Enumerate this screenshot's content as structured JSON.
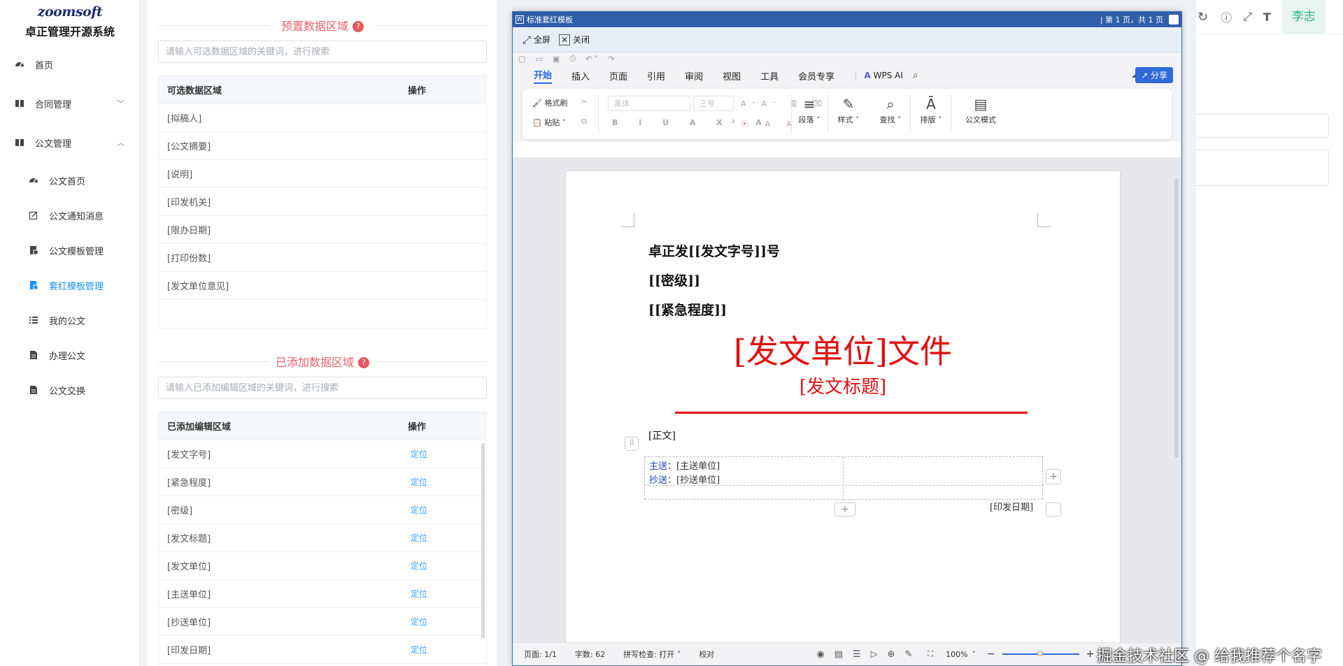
{
  "sidebar": {
    "brand": "zoomsoft",
    "system_name": "卓正管理开源系统",
    "items": [
      {
        "label": "首页"
      },
      {
        "label": "合同管理"
      },
      {
        "label": "公文管理"
      },
      {
        "label": "公文首页"
      },
      {
        "label": "公文通知消息"
      },
      {
        "label": "公文模板管理"
      },
      {
        "label": "套红模板管理"
      },
      {
        "label": "我的公文"
      },
      {
        "label": "办理公文"
      },
      {
        "label": "公文交换"
      }
    ]
  },
  "preset": {
    "title": "预置数据区域",
    "search_placeholder": "请输入可选数据区域的关键词，进行搜索",
    "col_area": "可选数据区域",
    "col_op": "操作",
    "rows": [
      "[拟稿人]",
      "[公文摘要]",
      "[说明]",
      "[印发机关]",
      "[限办日期]",
      "[打印份数]",
      "[发文单位意见]"
    ]
  },
  "added": {
    "title": "已添加数据区域",
    "search_placeholder": "请输入已添加编辑区域的关键词，进行搜索",
    "col_area": "已添加编辑区域",
    "col_op": "操作",
    "action": "定位",
    "rows": [
      "[发文字号]",
      "[紧急程度]",
      "[密级]",
      "[发文标题]",
      "[发文单位]",
      "[主送单位]",
      "[抄送单位]",
      "[印发日期]"
    ]
  },
  "topbar": {
    "user": "李志"
  },
  "wps": {
    "title": "标准套红模板",
    "page_info": "| 第 1 页，共 1 页",
    "fullscreen": "全屏",
    "close": "关闭",
    "menu": [
      "开始",
      "插入",
      "页面",
      "引用",
      "审阅",
      "视图",
      "工具",
      "会员专享"
    ],
    "wps_ai": "WPS AI",
    "share": "分享",
    "ribbon": {
      "format_painter": "格式刷",
      "paste": "粘贴",
      "font_name": "黑体",
      "font_size": "三号",
      "paragraph": "段落",
      "style": "样式",
      "find": "查找",
      "layout": "排版",
      "doc_mode": "公文模式"
    },
    "doc": {
      "line1": "卓正发[[发文字号]]号",
      "line2": "[[密级]]",
      "line3": "[[紧急程度]]",
      "red_title": "[发文单位]文件",
      "red_subtitle": "[发文标题]",
      "body": "[正文]",
      "to_label": "主送",
      "to_value": "：[主送单位]",
      "cc_label": "抄送",
      "cc_value": "：[抄送单位]",
      "date": "[印发日期]"
    },
    "status": {
      "page": "页面: 1/1",
      "words": "字数: 62",
      "spell": "拼写检查: 打开",
      "proof": "校对",
      "zoom": "100%"
    },
    "colors": {
      "accent": "#2f6bdb",
      "red": "#e01010"
    }
  },
  "watermark": "掘金技术社区 @ 给我推荐个名字"
}
